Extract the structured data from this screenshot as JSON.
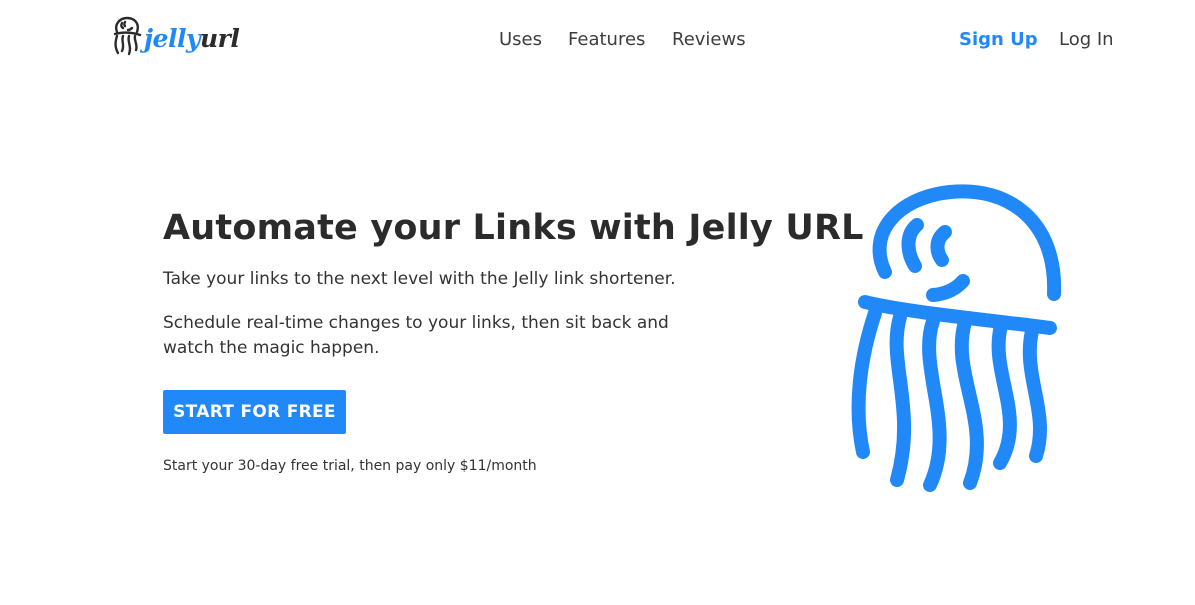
{
  "brand": {
    "name_part1": "jelly",
    "name_part2": "url",
    "logo_icon": "jellyfish-icon",
    "accent_color": "#2189f7",
    "dark_color": "#2b2b2b"
  },
  "nav": {
    "links": [
      "Uses",
      "Features",
      "Reviews"
    ],
    "signup_label": "Sign Up",
    "login_label": "Log In"
  },
  "hero": {
    "title": "Automate your Links with Jelly URL",
    "paragraph1": "Take your links to the next level with the Jelly link shortener.",
    "paragraph2": "Schedule real-time changes to your links, then sit back and watch the magic happen.",
    "cta_label": "START FOR FREE",
    "trial_note": "Start your 30-day free trial, then pay only $11/month",
    "illustration": "jellyfish-illustration",
    "illustration_color": "#2189f7"
  }
}
